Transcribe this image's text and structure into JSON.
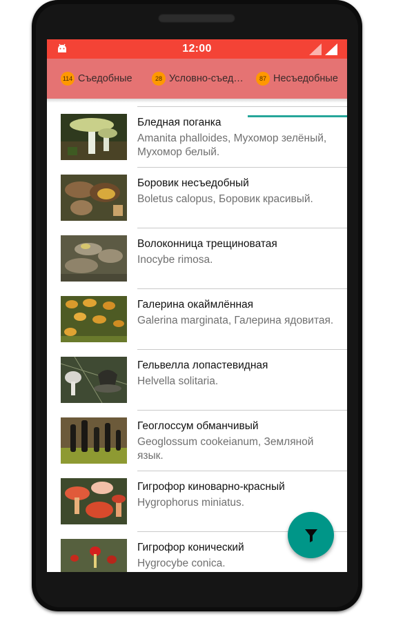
{
  "status_bar": {
    "time": "12:00"
  },
  "tabs": [
    {
      "count": "114",
      "label": "Съедобные"
    },
    {
      "count": "28",
      "label": "Условно-съед…"
    },
    {
      "count": "87",
      "label": "Несъедобные"
    }
  ],
  "active_tab": "Несъедобные",
  "mushrooms": [
    {
      "name": "Бледная поганка",
      "latin": "Amanita phalloides, Мухомор зелёный, Мухомор белый."
    },
    {
      "name": "Боровик несъедобный",
      "latin": "Boletus calopus, Боровик красивый."
    },
    {
      "name": "Волоконница трещиноватая",
      "latin": "Inocybe rimosa."
    },
    {
      "name": "Галерина окаймлённая",
      "latin": "Galerina marginata, Галерина ядовитая."
    },
    {
      "name": "Гельвелла лопастевидная",
      "latin": "Helvella solitaria."
    },
    {
      "name": "Геоглоссум обманчивый",
      "latin": "Geoglossum cookeianum, Земляной язык."
    },
    {
      "name": "Гигрофор киноварно-красный",
      "latin": "Hygrophorus miniatus."
    },
    {
      "name": "Гигрофор конический",
      "latin": "Hygrocybe conica."
    }
  ],
  "icons": {
    "status_left": "android-icon",
    "fab": "filter-icon"
  },
  "colors": {
    "status_bar": "#f44336",
    "tab_bar": "#e57373",
    "badge": "#ff9800",
    "accent": "#009688"
  }
}
